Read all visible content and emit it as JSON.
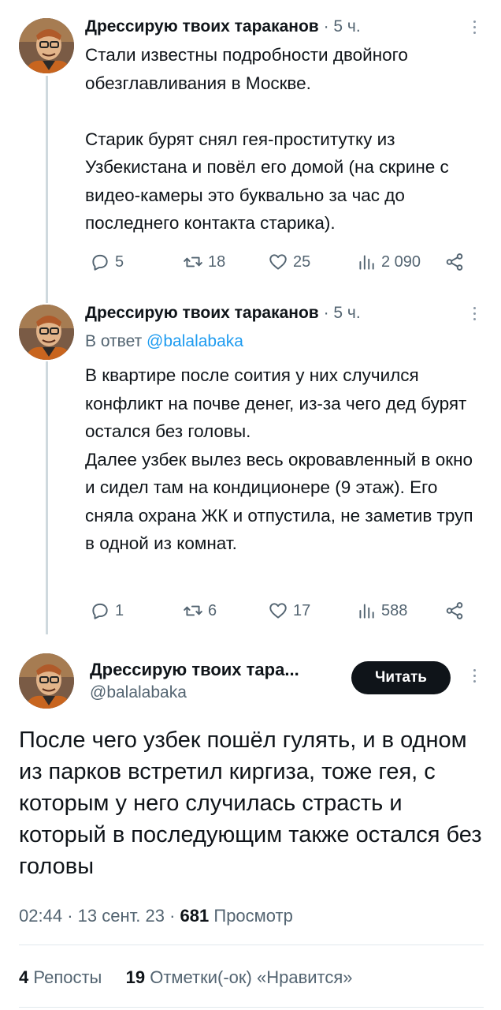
{
  "tweet1": {
    "author": "Дрессирую твоих тараканов",
    "time": "5 ч.",
    "text": "Стали известны подробности двойного обезглавливания в Москве.\n\nСтарик бурят снял гея-проститутку из Узбекистана и повёл его домой (на скрине с видео-камеры это буквально за час до последнего контакта старика).",
    "replies": "5",
    "reposts": "18",
    "likes": "25",
    "views": "2 090"
  },
  "tweet2": {
    "author": "Дрессирую твоих тараканов",
    "time": "5 ч.",
    "reply_prefix": "В ответ",
    "reply_handle": "@balalabaka",
    "text": "В квартире после соития у них случился конфликт на почве денег, из-за чего дед бурят остался без головы.\nДалее узбек вылез весь окровавленный в окно и сидел там на кондиционере (9 этаж). Его сняла охрана ЖК и отпустила, не заметив труп в одной из комнат.",
    "replies": "1",
    "reposts": "6",
    "likes": "17",
    "views": "588"
  },
  "main": {
    "author": "Дрессирую твоих тара...",
    "handle": "@balalabaka",
    "follow_label": "Читать",
    "text": "После чего узбек пошёл гулять, и в одном из парков встретил киргиза, тоже гея, с которым у него случилась страсть и который в последующим также остался без головы",
    "time": "02:44",
    "date": "13 сент. 23",
    "views": "681",
    "views_label": "Просмотр",
    "reposts_count": "4",
    "reposts_label": "Репосты",
    "likes_count": "19",
    "likes_label": "Отметки(-ок) «Нравится»"
  },
  "icons": {
    "reply": "reply-icon",
    "repost": "repost-icon",
    "like": "heart-icon",
    "views": "views-chart-icon",
    "share": "share-icon",
    "more": "more-vertical-icon"
  }
}
